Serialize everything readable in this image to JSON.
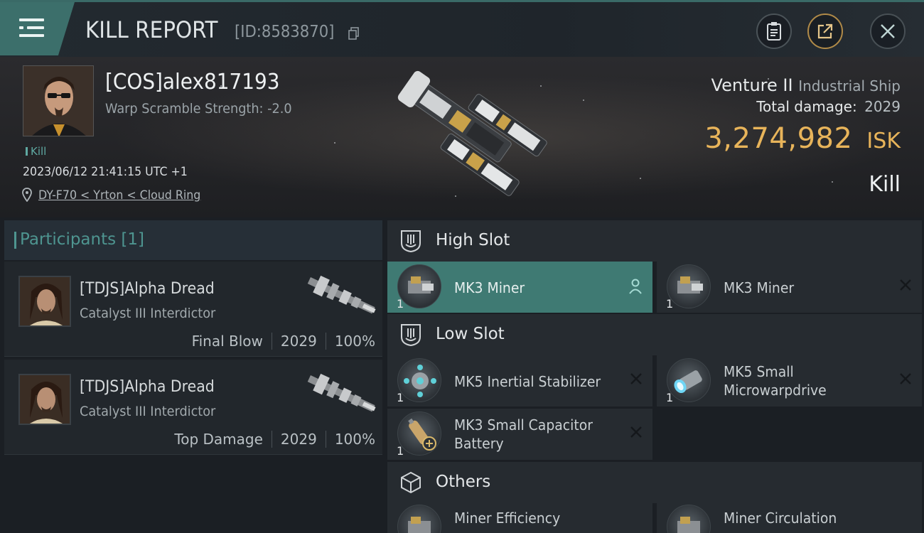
{
  "header": {
    "title": "KILL REPORT",
    "report_id": "[ID:8583870]",
    "buttons": {
      "clipboard_icon": "clipboard-icon",
      "share_icon": "share-icon",
      "close_icon": "close-icon"
    }
  },
  "victim": {
    "name": "[COS]alex817193",
    "warp_scramble": "Warp Scramble Strength: -2.0",
    "tag": "Kill",
    "datetime": "2023/06/12 21:41:15 UTC +1",
    "location": "DY-F70 < Yrton < Cloud Ring",
    "ship_name": "Venture II",
    "ship_class": "Industrial Ship",
    "total_damage_label": "Total damage:",
    "total_damage": "2029",
    "isk_value": "3,274,982",
    "isk_unit": "ISK",
    "result": "Kill"
  },
  "participants": {
    "label": "Participants [1]",
    "items": [
      {
        "name": "[TDJS]Alpha Dread",
        "ship": "Catalyst III Interdictor",
        "role": "Final Blow",
        "damage": "2029",
        "percent": "100%"
      },
      {
        "name": "[TDJS]Alpha Dread",
        "ship": "Catalyst III Interdictor",
        "role": "Top Damage",
        "damage": "2029",
        "percent": "100%"
      }
    ]
  },
  "slots": {
    "high": {
      "label": "High Slot",
      "items": [
        {
          "name": "MK3 Miner",
          "qty": "1"
        },
        {
          "name": "MK3 Miner",
          "qty": "1"
        }
      ]
    },
    "low": {
      "label": "Low Slot",
      "items": [
        {
          "name": "MK5 Inertial Stabilizer",
          "qty": "1"
        },
        {
          "name_line1": "MK5 Small",
          "name_line2": "Microwarpdrive",
          "qty": "1"
        },
        {
          "name_line1": "MK3 Small Capacitor",
          "name_line2": "Battery",
          "qty": "1"
        }
      ]
    },
    "others": {
      "label": "Others",
      "items": [
        {
          "name": "Miner Efficiency"
        },
        {
          "name": "Miner Circulation"
        }
      ]
    }
  },
  "colors": {
    "accent": "#3f7a73",
    "isk": "#e8b45a",
    "teal_text": "#4e9590"
  }
}
